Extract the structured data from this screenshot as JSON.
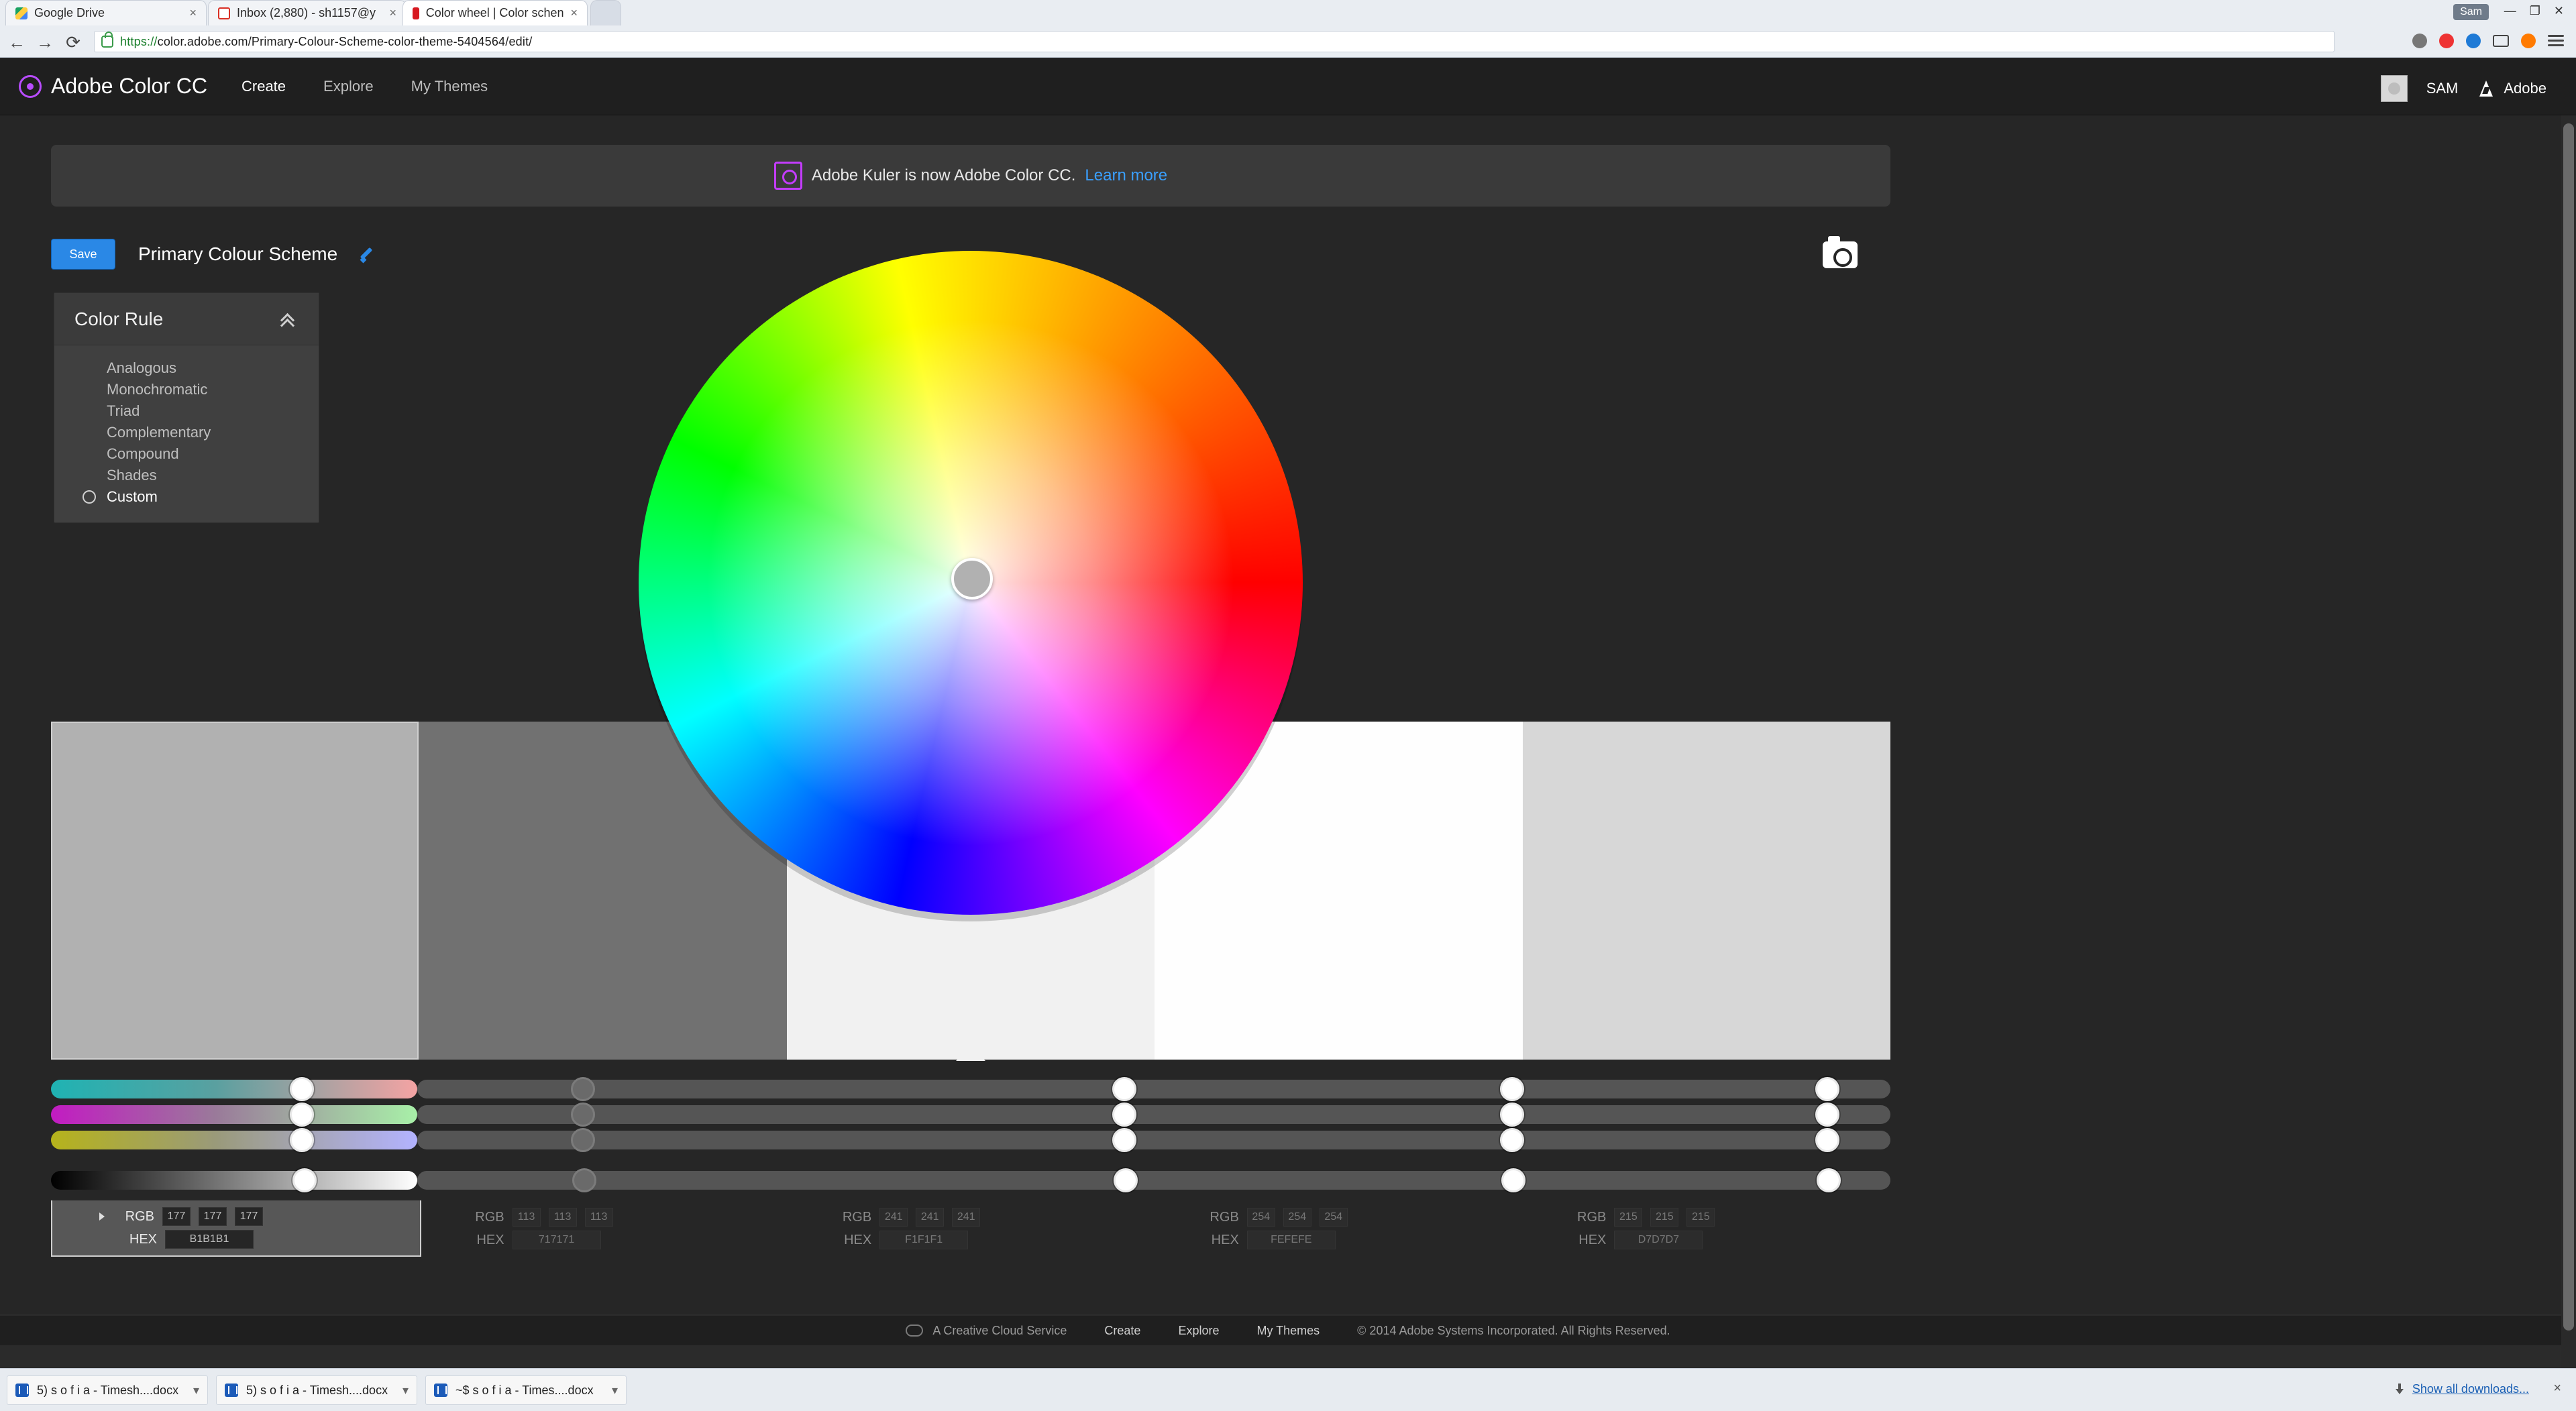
{
  "browser": {
    "tabs": [
      {
        "title": "Google Drive",
        "active": false
      },
      {
        "title": "Inbox (2,880) - sh1157@y",
        "active": false
      },
      {
        "title": "Color wheel | Color schen",
        "active": true
      }
    ],
    "profile": "Sam",
    "url_prefix": "https://",
    "url_rest": "color.adobe.com/Primary-Colour-Scheme-color-theme-5404564/edit/"
  },
  "app": {
    "brand": "Adobe Color CC",
    "nav": [
      "Create",
      "Explore",
      "My Themes"
    ],
    "user": "SAM",
    "adobe": "Adobe"
  },
  "banner": {
    "text": "Adobe Kuler is now Adobe Color CC.",
    "link": "Learn more"
  },
  "theme": {
    "save_label": "Save",
    "name": "Primary Colour Scheme"
  },
  "color_rule": {
    "title": "Color Rule",
    "items": [
      "Analogous",
      "Monochromatic",
      "Triad",
      "Complementary",
      "Compound",
      "Shades",
      "Custom"
    ],
    "selected": "Custom"
  },
  "swatches": [
    {
      "hex_label": "B1B1B1",
      "rgb": [
        "177",
        "177",
        "177"
      ],
      "color": "#b1b1b1",
      "active": true
    },
    {
      "hex_label": "717171",
      "rgb": [
        "113",
        "113",
        "113"
      ],
      "color": "#717171",
      "active": false
    },
    {
      "hex_label": "F1F1F1",
      "rgb": [
        "241",
        "241",
        "241"
      ],
      "color": "#f1f1f1",
      "active": false
    },
    {
      "hex_label": "FEFEFE",
      "rgb": [
        "254",
        "254",
        "254"
      ],
      "color": "#fefefe",
      "active": false
    },
    {
      "hex_label": "D7D7D7",
      "rgb": [
        "215",
        "215",
        "215"
      ],
      "color": "#d7d7d7",
      "active": false
    }
  ],
  "labels": {
    "rgb": "RGB",
    "hex": "HEX"
  },
  "footer": {
    "service": "A Creative Cloud Service",
    "links": [
      "Create",
      "Explore",
      "My Themes"
    ],
    "copyright": "© 2014 Adobe Systems Incorporated. All Rights Reserved."
  },
  "downloads": {
    "items": [
      "5) s o f i a - Timesh....docx",
      "5) s o f i a - Timesh....docx",
      "~$ s o f i a - Times....docx"
    ],
    "show_all": "Show all downloads..."
  }
}
